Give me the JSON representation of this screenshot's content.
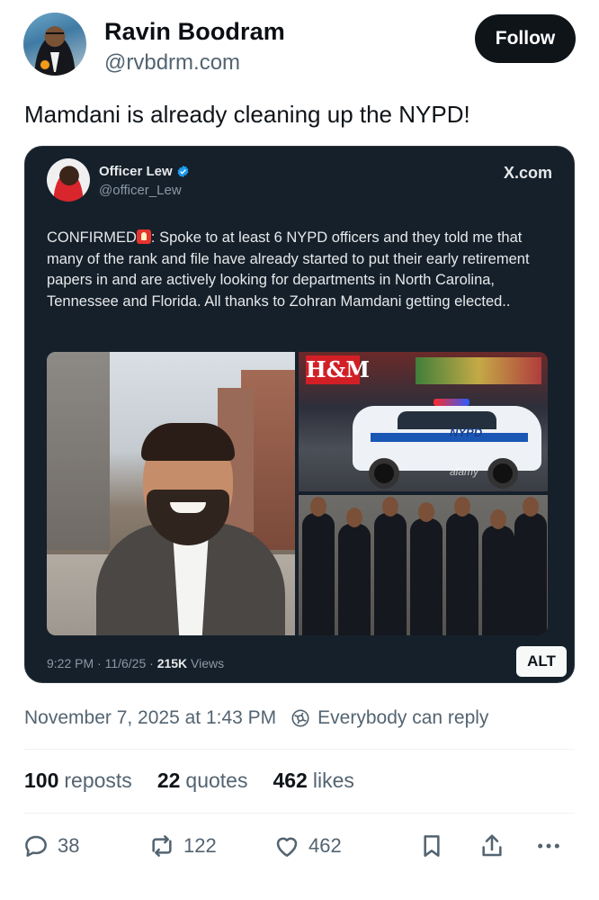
{
  "header": {
    "display_name": "Ravin Boodram",
    "handle": "@rvbdrm.com",
    "follow_label": "Follow"
  },
  "post": {
    "text": "Mamdani is already cleaning up the NYPD!"
  },
  "quoted": {
    "name": "Officer Lew",
    "handle": "@officer_Lew",
    "source": "X.com",
    "text_before": "CONFIRMED",
    "text_after": ": Spoke to at least 6  NYPD officers and they told me that many of the rank and file have already started to put their early retirement papers in and are actively looking for departments in North Carolina, Tennessee and Florida. All thanks to Zohran Mamdani getting elected..",
    "time": "9:22 PM · 11/6/25 · ",
    "views_count": "215K",
    "views_label": " Views",
    "alt_label": "ALT",
    "image_sign": "H&M",
    "image_car_label": "NYPD",
    "image_watermark": "alamy"
  },
  "timestamp": {
    "date": "November 7, 2025 at 1:43 PM",
    "reply_setting": "Everybody can reply"
  },
  "stats": {
    "reposts_count": "100",
    "reposts_label": "reposts",
    "quotes_count": "22",
    "quotes_label": "quotes",
    "likes_count": "462",
    "likes_label": "likes"
  },
  "actions": {
    "replies": "38",
    "reposts": "122",
    "likes": "462"
  },
  "icons": {
    "reply": "reply-icon",
    "repost": "repost-icon",
    "like": "heart-icon",
    "bookmark": "bookmark-icon",
    "share": "share-icon",
    "more": "more-icon",
    "verified": "verified-badge-icon",
    "reply_setting": "globe-icon"
  },
  "colors": {
    "accent": "#1d9bf0",
    "text_secondary": "#536471",
    "embed_bg": "#15202b"
  }
}
